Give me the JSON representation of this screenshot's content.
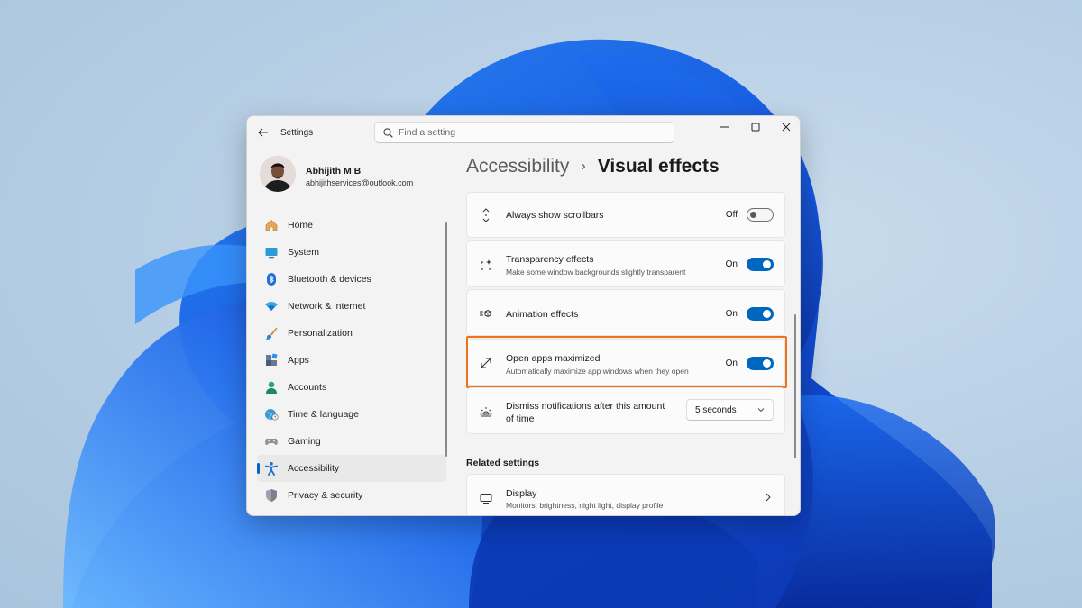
{
  "app": {
    "title": "Settings"
  },
  "search": {
    "placeholder": "Find a setting"
  },
  "profile": {
    "name": "Abhijith M B",
    "email": "abhijithservices@outlook.com"
  },
  "nav": {
    "items": [
      {
        "label": "Home",
        "icon": "home-icon"
      },
      {
        "label": "System",
        "icon": "system-icon"
      },
      {
        "label": "Bluetooth & devices",
        "icon": "bluetooth-icon"
      },
      {
        "label": "Network & internet",
        "icon": "wifi-icon"
      },
      {
        "label": "Personalization",
        "icon": "brush-icon"
      },
      {
        "label": "Apps",
        "icon": "apps-icon"
      },
      {
        "label": "Accounts",
        "icon": "person-icon"
      },
      {
        "label": "Time & language",
        "icon": "globe-icon"
      },
      {
        "label": "Gaming",
        "icon": "gamepad-icon"
      },
      {
        "label": "Accessibility",
        "icon": "accessibility-icon",
        "active": true
      },
      {
        "label": "Privacy & security",
        "icon": "shield-icon"
      }
    ]
  },
  "breadcrumb": {
    "parent": "Accessibility",
    "separator": "›",
    "current": "Visual effects"
  },
  "settings": {
    "scrollbars": {
      "title": "Always show scrollbars",
      "state": "Off"
    },
    "transparency": {
      "title": "Transparency effects",
      "desc": "Make some window backgrounds slightly transparent",
      "state": "On"
    },
    "animation": {
      "title": "Animation effects",
      "state": "On"
    },
    "maximized": {
      "title": "Open apps maximized",
      "desc": "Automatically maximize app windows when they open",
      "state": "On"
    },
    "notifications": {
      "title_line1": "Dismiss notifications after this amount",
      "title_line2": "of time",
      "value": "5 seconds"
    }
  },
  "related": {
    "heading": "Related settings",
    "display": {
      "title": "Display",
      "desc": "Monitors, brightness, night light, display profile"
    }
  },
  "colors": {
    "accent": "#0067c0",
    "highlight": "#f0711c",
    "wallpaper": "#1e64e6"
  }
}
